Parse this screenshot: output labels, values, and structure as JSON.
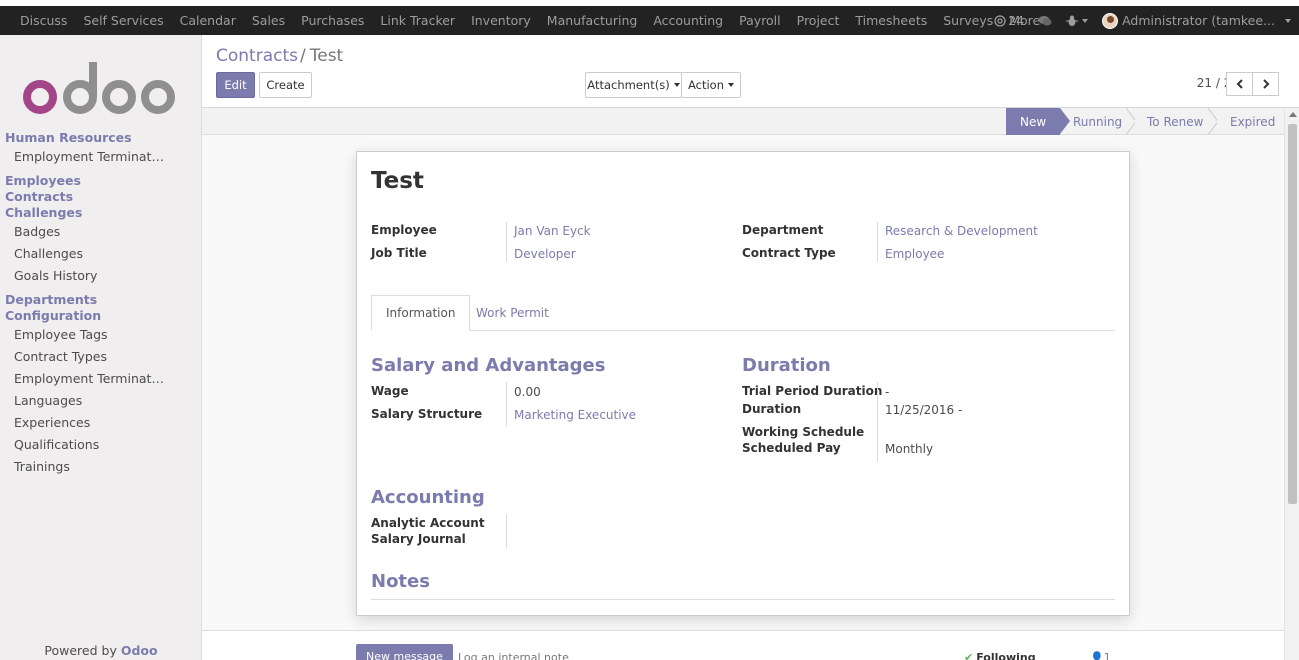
{
  "topbar": {
    "apps": [
      "Discuss",
      "Self Services",
      "Calendar",
      "Sales",
      "Purchases",
      "Link Tracker",
      "Inventory",
      "Manufacturing",
      "Accounting",
      "Payroll",
      "Project",
      "Timesheets",
      "Surveys",
      "More"
    ],
    "messages_count": "24",
    "user": "Administrator (tamkee..."
  },
  "sidebar": {
    "logo_text": "odoo",
    "sections": [
      {
        "head": "Human Resources",
        "items": [
          "Employment Termination"
        ]
      },
      {
        "heads": [
          "Employees",
          "Contracts",
          "Challenges"
        ],
        "items": [
          "Badges",
          "Challenges",
          "Goals History"
        ]
      },
      {
        "heads": [
          "Departments",
          "Configuration"
        ],
        "items": [
          "Employee Tags",
          "Contract Types",
          "Employment Termination ...",
          "Languages",
          "Experiences",
          "Qualifications",
          "Trainings"
        ]
      }
    ],
    "powered_prefix": "Powered by ",
    "powered_brand": "Odoo"
  },
  "control": {
    "breadcrumb_parent": "Contracts",
    "breadcrumb_sep": "/",
    "breadcrumb_current": "Test",
    "edit_label": "Edit",
    "create_label": "Create",
    "attachments_label": "Attachment(s)",
    "action_label": "Action",
    "pager": "21 / 21"
  },
  "statusbar": {
    "stages": [
      "New",
      "Running",
      "To Renew",
      "Expired"
    ],
    "active": "New"
  },
  "form": {
    "title": "Test",
    "employee_label": "Employee",
    "employee_value": "Jan Van Eyck",
    "job_title_label": "Job Title",
    "job_title_value": "Developer",
    "department_label": "Department",
    "department_value": "Research & Development",
    "contract_type_label": "Contract Type",
    "contract_type_value": "Employee",
    "tabs": [
      "Information",
      "Work Permit"
    ],
    "salary_section": "Salary and Advantages",
    "wage_label": "Wage",
    "wage_value": "0.00",
    "salary_structure_label": "Salary Structure",
    "salary_structure_value": "Marketing Executive",
    "duration_section": "Duration",
    "trial_label": "Trial Period Duration",
    "trial_value": "-",
    "duration_label": "Duration",
    "duration_value": "11/25/2016 -",
    "working_schedule_label": "Working Schedule",
    "scheduled_pay_label": "Scheduled Pay",
    "scheduled_pay_value": "Monthly",
    "accounting_section": "Accounting",
    "analytic_label": "Analytic Account",
    "salary_journal_label": "Salary Journal",
    "notes_section": "Notes"
  },
  "chatter": {
    "new_message": "New message",
    "log_note": "Log an internal note",
    "following": "Following",
    "followers": "1"
  },
  "colors": {
    "accent": "#7c7bad",
    "topbar": "#222222"
  }
}
